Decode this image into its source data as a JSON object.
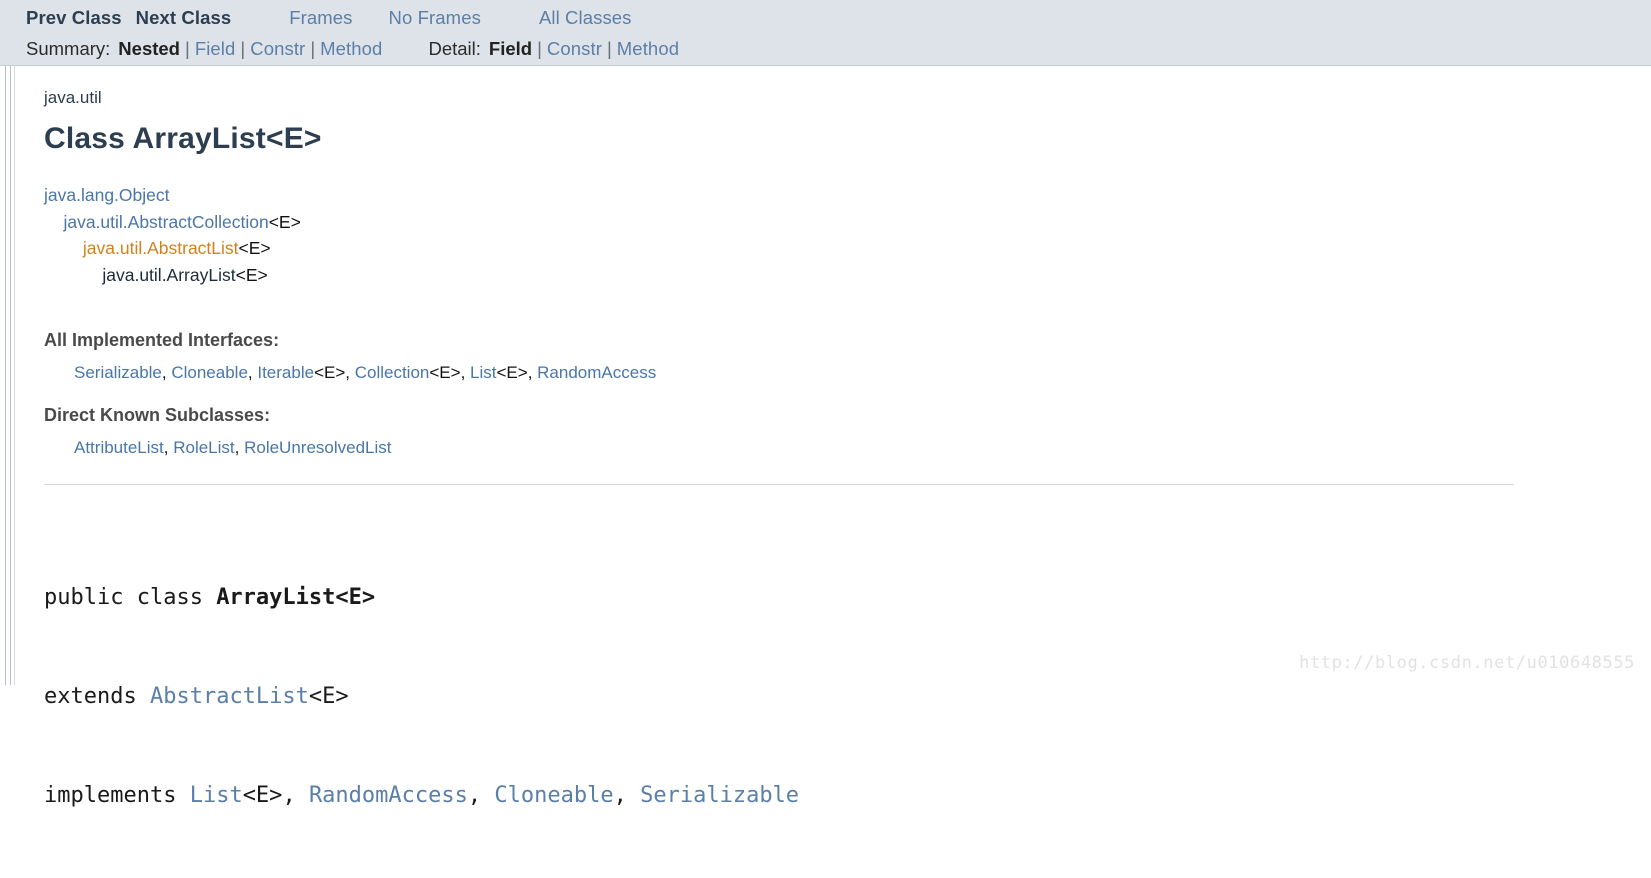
{
  "navbar": {
    "prev_class": "Prev Class",
    "next_class": "Next Class",
    "frames": "Frames",
    "no_frames": "No Frames",
    "all_classes": "All Classes",
    "summary_label": "Summary:",
    "summary_items": [
      "Nested",
      "Field",
      "Constr",
      "Method"
    ],
    "detail_label": "Detail:",
    "detail_items": [
      "Field",
      "Constr",
      "Method"
    ],
    "separator": "|"
  },
  "header": {
    "package": "java.util",
    "title": "Class ArrayList<E>"
  },
  "inheritance": [
    {
      "indent": 0,
      "link": "java.lang.Object",
      "generic": "",
      "style": "link"
    },
    {
      "indent": 1,
      "link": "java.util.AbstractCollection",
      "generic": "<E>",
      "style": "link"
    },
    {
      "indent": 2,
      "link": "java.util.AbstractList",
      "generic": "<E>",
      "style": "visited"
    },
    {
      "indent": 3,
      "link": "java.util.ArrayList",
      "generic": "<E>",
      "style": "current"
    }
  ],
  "implemented_interfaces": {
    "heading": "All Implemented Interfaces:",
    "items": [
      {
        "name": "Serializable",
        "generic": ""
      },
      {
        "name": "Cloneable",
        "generic": ""
      },
      {
        "name": "Iterable",
        "generic": "<E>"
      },
      {
        "name": "Collection",
        "generic": "<E>"
      },
      {
        "name": "List",
        "generic": "<E>"
      },
      {
        "name": "RandomAccess",
        "generic": ""
      }
    ]
  },
  "known_subclasses": {
    "heading": "Direct Known Subclasses:",
    "items": [
      "AttributeList",
      "RoleList",
      "RoleUnresolvedList"
    ]
  },
  "declaration": {
    "line1_modifiers": "public class ",
    "line1_name": "ArrayList<E>",
    "line2_keyword": "extends ",
    "line2_type": "AbstractList",
    "line2_generic": "<E>",
    "line3_keyword": "implements ",
    "line3_types": [
      {
        "name": "List",
        "generic": "<E>"
      },
      {
        "name": "RandomAccess",
        "generic": ""
      },
      {
        "name": "Cloneable",
        "generic": ""
      },
      {
        "name": "Serializable",
        "generic": ""
      }
    ]
  },
  "watermark": "http://blog.csdn.net/u010648555",
  "colors": {
    "navbar_bg": "#dee3e9",
    "link": "#4a76a8",
    "visited_link": "#d1831a",
    "title": "#2c3e50",
    "heading": "#4a4a4a"
  }
}
